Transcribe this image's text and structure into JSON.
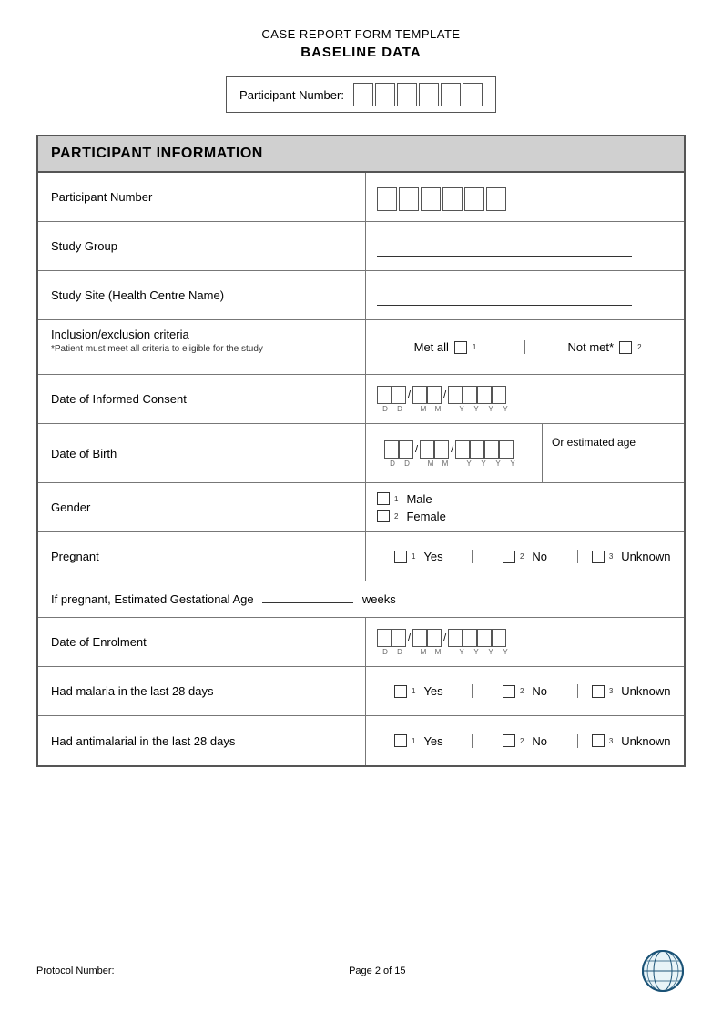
{
  "header": {
    "title": "CASE REPORT FORM TEMPLATE",
    "subtitle": "BASELINE DATA"
  },
  "participant_number_section": {
    "label": "Participant Number:",
    "cells": [
      "",
      "",
      "",
      "",
      "",
      ""
    ]
  },
  "section": {
    "title": "PARTICIPANT INFORMATION",
    "rows": [
      {
        "id": "participant-number",
        "label": "Participant Number",
        "type": "number-cells"
      },
      {
        "id": "study-group",
        "label": "Study Group",
        "type": "underline"
      },
      {
        "id": "study-site",
        "label": "Study Site (Health Centre Name)",
        "type": "underline"
      },
      {
        "id": "inclusion",
        "label": "Inclusion/exclusion criteria",
        "sub": "*Patient must meet all criteria to eligible for the study",
        "type": "inclusion"
      },
      {
        "id": "date-informed-consent",
        "label": "Date of Informed Consent",
        "type": "date"
      },
      {
        "id": "date-birth",
        "label": "Date of Birth",
        "type": "date-with-estimated"
      },
      {
        "id": "gender",
        "label": "Gender",
        "type": "gender"
      },
      {
        "id": "pregnant",
        "label": "Pregnant",
        "type": "ynu"
      },
      {
        "id": "gestational-age",
        "label": "gestational",
        "type": "gestational"
      },
      {
        "id": "date-enrolment",
        "label": "Date of Enrolment",
        "type": "date"
      },
      {
        "id": "had-malaria",
        "label": "Had malaria in the last 28 days",
        "type": "ynu"
      },
      {
        "id": "had-antimalarial",
        "label": "Had antimalarial in the last 28 days",
        "type": "ynu"
      }
    ]
  },
  "inclusion": {
    "met_all": "Met all",
    "not_met": "Not met*"
  },
  "gender": {
    "option1_num": "1",
    "option1_label": "Male",
    "option2_num": "2",
    "option2_label": "Female"
  },
  "ynu": {
    "yes_num": "1",
    "yes_label": "Yes",
    "no_num": "2",
    "no_label": "No",
    "unknown_num": "3",
    "unknown_label": "Unknown"
  },
  "gestational": {
    "prefix": "If pregnant, Estimated Gestational Age",
    "suffix": "weeks"
  },
  "estimated_age": {
    "label": "Or estimated age"
  },
  "date_labels": {
    "d": "D",
    "d2": "D",
    "m": "M",
    "m2": "M",
    "y1": "Y",
    "y2": "Y",
    "y3": "Y",
    "y4": "Y"
  },
  "footer": {
    "protocol": "Protocol Number:",
    "page": "Page 2 of 15"
  }
}
